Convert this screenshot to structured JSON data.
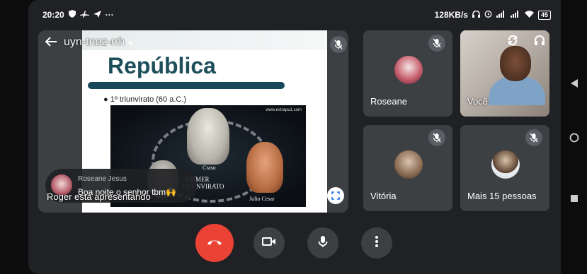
{
  "status_bar": {
    "time": "20:20",
    "left_icons": [
      "shield-icon",
      "airplane-icon",
      "send-icon"
    ],
    "overflow_dots": "···",
    "net_speed": "128KB/s",
    "battery": "45"
  },
  "presentation": {
    "meeting_code": "uyn-tnoz-rrh",
    "code_chevron": "▸",
    "slide": {
      "title": "República",
      "bullet": "1º triunvirato (60 a.C.)",
      "site": "www.estrapu1.com",
      "image_labels": {
        "crasso": "Craso",
        "primer": "PRIMER",
        "triunvirato": "TRIUNVIRATO",
        "julio": "Julio Cesar"
      }
    },
    "presenter_label": "Roger está apresentando"
  },
  "chat_toast": {
    "sender": "Roseane Jesus",
    "message": "Boa noite,o senhor tbm🙌"
  },
  "participants": [
    {
      "name": "Roseane",
      "muted": true
    },
    {
      "name": "Você",
      "muted": false
    },
    {
      "name": "Vitória",
      "muted": true
    },
    {
      "name": "Mais 15 pessoas",
      "muted": true
    }
  ],
  "controls": [
    "end-call",
    "camera",
    "microphone",
    "more-options"
  ],
  "colors": {
    "end_call": "#ea4335",
    "tile_bg": "#3c4043",
    "app_bg": "#202124",
    "slide_title": "#1d4f5b"
  }
}
